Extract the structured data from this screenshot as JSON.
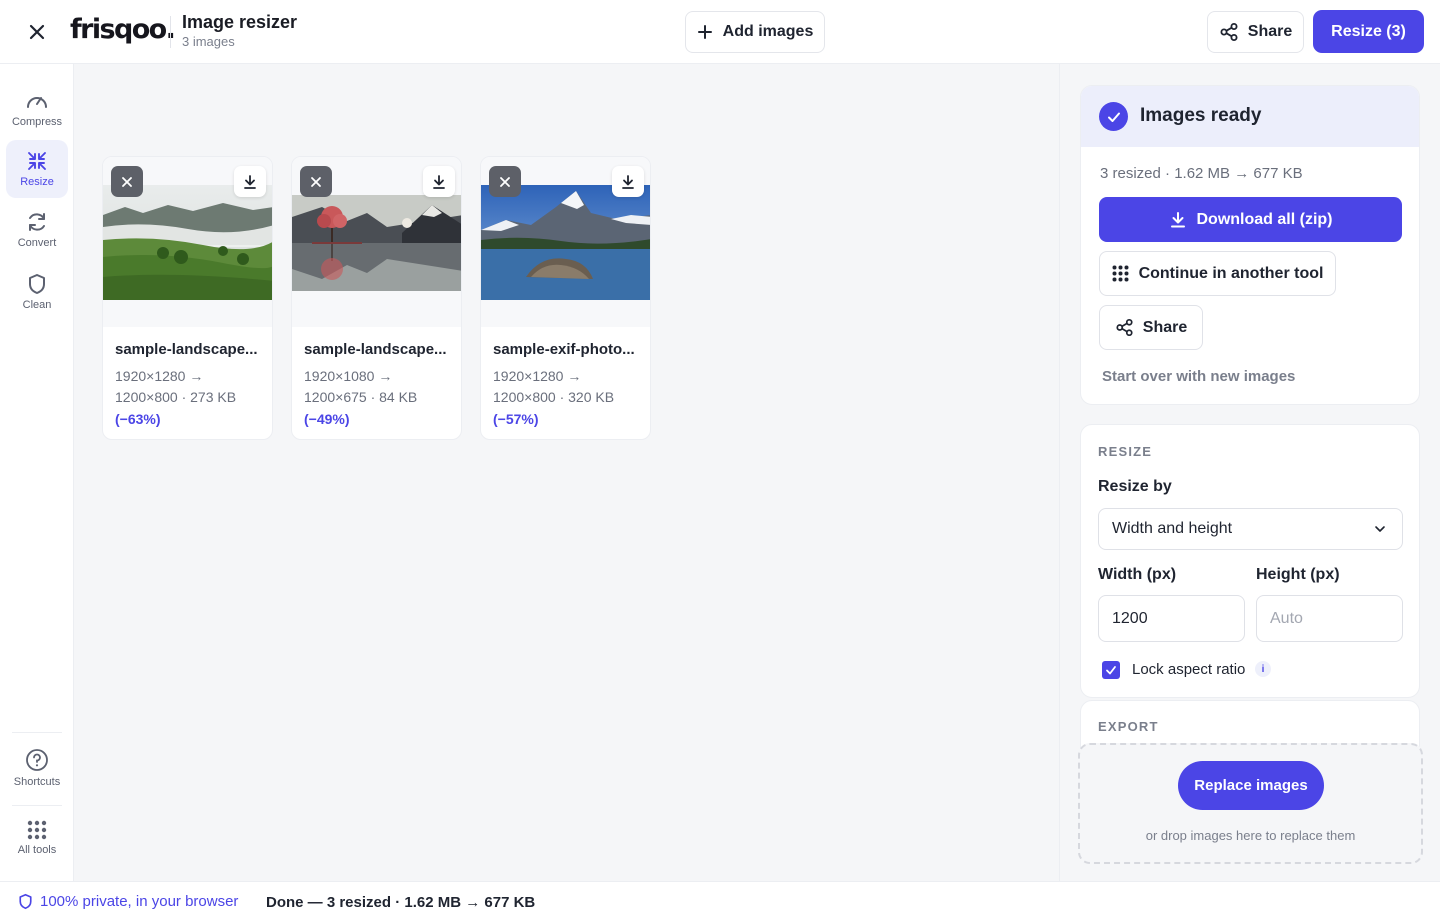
{
  "topbar": {
    "logo": "frisqoo.",
    "title": "Image resizer",
    "subtitle": "3 images",
    "add_images_label": "Add images",
    "share_label": "Share",
    "resize_label": "Resize (3)"
  },
  "rail": {
    "items": [
      {
        "label": "Compress",
        "icon": "gauge-icon"
      },
      {
        "label": "Resize",
        "icon": "shrink-arrows-icon",
        "active": true
      },
      {
        "label": "Convert",
        "icon": "refresh-icon"
      },
      {
        "label": "Clean",
        "icon": "shield-icon"
      }
    ],
    "bottom": [
      {
        "label": "Shortcuts",
        "icon": "help-circle-icon"
      },
      {
        "label": "All tools",
        "icon": "grid-icon"
      }
    ]
  },
  "images": [
    {
      "name": "sample-landscape...",
      "from": "1920×1280 →",
      "to": "1200×800 · 273 KB",
      "savings": "(−63%)",
      "thumb": "misty-hills"
    },
    {
      "name": "sample-landscape...",
      "from": "1920×1080 →",
      "to": "1200×675 · 84 KB",
      "savings": "(−49%)",
      "thumb": "lake-tree"
    },
    {
      "name": "sample-exif-photo...",
      "from": "1920×1280 →",
      "to": "1200×800 · 320 KB",
      "savings": "(−57%)",
      "thumb": "mountain-lake"
    }
  ],
  "panel": {
    "ready_title": "Images ready",
    "ready_stats": "3 resized · 1.62 MB → 677 KB",
    "download_all_label": "Download all (zip)",
    "continue_label": "Continue in another tool",
    "share_label": "Share",
    "start_over_label": "Start over with new images",
    "resize_section": "RESIZE",
    "resize_by_label": "Resize by",
    "resize_by_value": "Width and height",
    "width_label": "Width (px)",
    "width_value": "1200",
    "height_label": "Height (px)",
    "height_placeholder": "Auto",
    "lock_label": "Lock aspect ratio",
    "lock_checked": true,
    "info_label": "i",
    "export_section": "EXPORT",
    "replace_label": "Replace images",
    "drop_hint": "or drop images here to replace them"
  },
  "status": {
    "privacy": "100% private, in your browser",
    "text": "Done — 3 resized · 1.62 MB → 677 KB"
  },
  "colors": {
    "accent": "#4b45e6",
    "accent_soft": "#eceefb",
    "text": "#1f2430",
    "muted": "#7a7f8c",
    "canvas_bg": "#f5f6f8"
  }
}
